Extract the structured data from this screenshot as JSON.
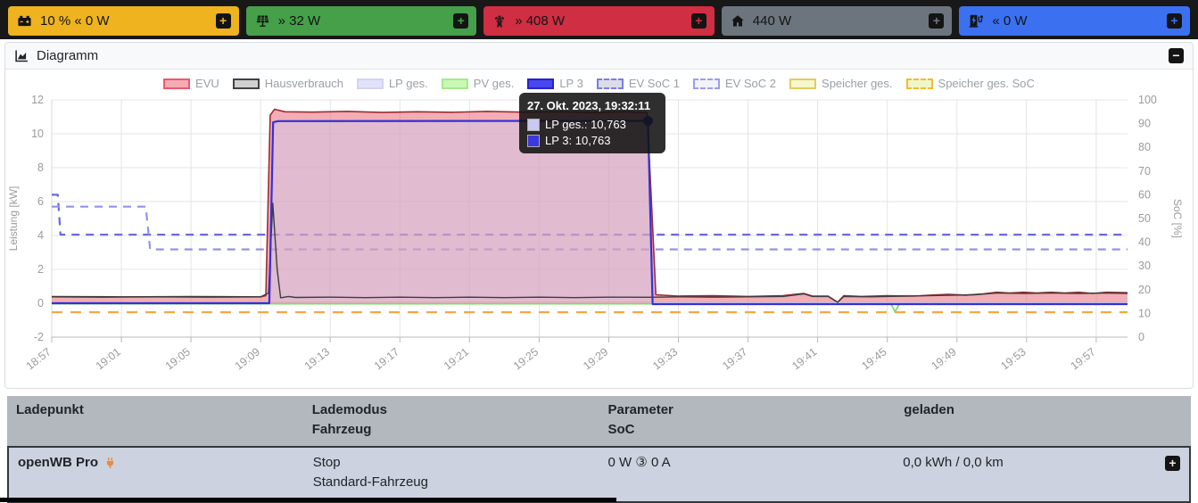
{
  "topbar": {
    "add_button_label": "+",
    "boxes": [
      {
        "name": "battery",
        "icon": "car-battery-icon",
        "color": "#eeb31e",
        "label": "10 % « 0 W"
      },
      {
        "name": "pv",
        "icon": "solar-panel-icon",
        "color": "#45a049",
        "label": "» 32 W"
      },
      {
        "name": "grid",
        "icon": "transmission-tower-icon",
        "color": "#d02e42",
        "label": "» 408 W"
      },
      {
        "name": "house",
        "icon": "home-icon",
        "color": "#6c757d",
        "label": "440 W"
      },
      {
        "name": "chargepoint",
        "icon": "charging-station-icon",
        "color": "#3b71f1",
        "label": "« 0 W"
      }
    ]
  },
  "diagram_panel": {
    "title": "Diagramm",
    "collapse_button_label": "−"
  },
  "tooltip": {
    "title": "27. Okt. 2023, 19:32:11",
    "rows": [
      {
        "swatch": "#c9c9f2",
        "text": "LP ges.: 10,763"
      },
      {
        "swatch": "#3b38dc",
        "text": "LP 3: 10,763"
      }
    ]
  },
  "chart_data": {
    "type": "line",
    "title": "",
    "x_tick_labels": [
      "18:57",
      "19:01",
      "19:05",
      "19:09",
      "19:13",
      "19:17",
      "19:21",
      "19:25",
      "19:29",
      "19:33",
      "19:37",
      "19:41",
      "19:45",
      "19:49",
      "19:53",
      "19:57"
    ],
    "x_tick_minutes": [
      0,
      4,
      8,
      12,
      16,
      20,
      24,
      28,
      32,
      36,
      40,
      44,
      48,
      52,
      56,
      60
    ],
    "x_range": [
      0,
      61.8
    ],
    "grid": true,
    "legend_position": "top",
    "axes": {
      "left": {
        "label": "Leistung [kW]",
        "min": -2,
        "max": 12,
        "ticks": [
          -2,
          0,
          2,
          4,
          6,
          8,
          10,
          12
        ]
      },
      "right": {
        "label": "SoC [%]",
        "min": 0,
        "max": 100,
        "ticks": [
          0,
          10,
          20,
          30,
          40,
          50,
          60,
          70,
          80,
          90,
          100
        ]
      }
    },
    "legend": [
      {
        "label": "EVU",
        "fill": "#f5abb4",
        "stroke": "#ee5a6a",
        "dash": false
      },
      {
        "label": "Hausverbrauch",
        "fill": "#d0d0d0",
        "stroke": "#424242",
        "dash": false
      },
      {
        "label": "LP ges.",
        "fill": "#e2e2f9",
        "stroke": "#d3d3f4",
        "dash": false
      },
      {
        "label": "PV ges.",
        "fill": "#c9f7b4",
        "stroke": "#a6ea8e",
        "dash": false
      },
      {
        "label": "LP 3",
        "fill": "#4a47ec",
        "stroke": "#2724ce",
        "dash": false
      },
      {
        "label": "EV SoC 1",
        "fill": "#dcdce9",
        "stroke": "#7c7ce4",
        "dash": true
      },
      {
        "label": "EV SoC 2",
        "fill": "#f2f2fb",
        "stroke": "#9d9dee",
        "dash": true
      },
      {
        "label": "Speicher ges.",
        "fill": "#f6f8c9",
        "stroke": "#e2ca66",
        "dash": false
      },
      {
        "label": "Speicher ges. SoC",
        "fill": "#f0f6c5",
        "stroke": "#f2ba36",
        "dash": true
      }
    ],
    "series": [
      {
        "name": "EV SoC 1",
        "axis": "right",
        "color": "#6a6ada",
        "width": 2.2,
        "dash": "9 7",
        "points": [
          [
            0,
            60
          ],
          [
            0.35,
            60
          ],
          [
            0.5,
            43.2
          ],
          [
            61.8,
            43.2
          ]
        ]
      },
      {
        "name": "EV SoC 2",
        "axis": "right",
        "color": "#9292ea",
        "width": 2.2,
        "dash": "9 7",
        "points": [
          [
            0,
            55
          ],
          [
            5.4,
            55
          ],
          [
            5.65,
            37
          ],
          [
            61.8,
            37
          ]
        ]
      },
      {
        "name": "Speicher ges. SoC",
        "axis": "right",
        "color": "#f5a844",
        "width": 2.2,
        "dash": "12 9",
        "points": [
          [
            0,
            10.5
          ],
          [
            61.8,
            10.5
          ]
        ]
      },
      {
        "name": "Speicher ges.",
        "axis": "left",
        "color": "#e3dd8d",
        "width": 1.5,
        "points": [
          [
            0,
            0.05
          ],
          [
            61.8,
            0.05
          ]
        ]
      },
      {
        "name": "PV ges.",
        "axis": "left",
        "color": "#7ddb6b",
        "width": 1.8,
        "points": [
          [
            0,
            -0.03
          ],
          [
            48.2,
            -0.03
          ],
          [
            48.45,
            -0.5
          ],
          [
            48.7,
            -0.03
          ],
          [
            61.8,
            -0.03
          ]
        ]
      },
      {
        "name": "EVU",
        "axis": "left",
        "color": "#9e2b36",
        "width": 1.6,
        "fill": "rgba(232,92,106,0.5)",
        "baseline": 0,
        "points": [
          [
            0,
            0.38
          ],
          [
            3,
            0.36
          ],
          [
            6,
            0.38
          ],
          [
            9,
            0.36
          ],
          [
            12,
            0.38
          ],
          [
            12.3,
            0.45
          ],
          [
            12.55,
            11.1
          ],
          [
            12.8,
            11.45
          ],
          [
            13.4,
            11.3
          ],
          [
            15,
            11.28
          ],
          [
            17,
            11.32
          ],
          [
            19,
            11.26
          ],
          [
            21,
            11.3
          ],
          [
            23,
            11.27
          ],
          [
            25,
            11.32
          ],
          [
            27,
            11.28
          ],
          [
            29,
            11.3
          ],
          [
            31,
            11.27
          ],
          [
            33,
            11.3
          ],
          [
            34.2,
            11.25
          ],
          [
            34.45,
            6
          ],
          [
            34.7,
            0.5
          ],
          [
            36,
            0.42
          ],
          [
            38,
            0.44
          ],
          [
            40,
            0.4
          ],
          [
            42,
            0.44
          ],
          [
            43.2,
            0.58
          ],
          [
            43.7,
            0.42
          ],
          [
            44.6,
            0.42
          ],
          [
            45.15,
            0.06
          ],
          [
            45.5,
            0.44
          ],
          [
            46.5,
            0.4
          ],
          [
            48,
            0.44
          ],
          [
            49.5,
            0.42
          ],
          [
            50.5,
            0.48
          ],
          [
            51.5,
            0.52
          ],
          [
            52.5,
            0.48
          ],
          [
            53.5,
            0.55
          ],
          [
            54.3,
            0.65
          ],
          [
            55,
            0.6
          ],
          [
            55.8,
            0.65
          ],
          [
            56.6,
            0.6
          ],
          [
            57.4,
            0.65
          ],
          [
            58.2,
            0.6
          ],
          [
            59,
            0.65
          ],
          [
            59.8,
            0.58
          ],
          [
            60.6,
            0.65
          ],
          [
            61.8,
            0.62
          ]
        ]
      },
      {
        "name": "LP ges.",
        "axis": "left",
        "color": "#c9c9f2",
        "width": 2,
        "fill": "rgba(205,205,240,0.45)",
        "baseline": 0,
        "points": [
          [
            0,
            0.02
          ],
          [
            12.5,
            0.02
          ],
          [
            12.72,
            10.7
          ],
          [
            13,
            10.76
          ],
          [
            34.25,
            10.76
          ],
          [
            34.5,
            0.02
          ],
          [
            61.8,
            0.02
          ]
        ]
      },
      {
        "name": "Hausverbrauch",
        "axis": "left",
        "color": "#3d3d3d",
        "width": 1.4,
        "points": [
          [
            0,
            0.4
          ],
          [
            4,
            0.38
          ],
          [
            8,
            0.4
          ],
          [
            12,
            0.38
          ],
          [
            12.45,
            0.6
          ],
          [
            12.7,
            5.9
          ],
          [
            12.95,
            2
          ],
          [
            13.15,
            0.32
          ],
          [
            13.6,
            0.4
          ],
          [
            14,
            0.34
          ],
          [
            16,
            0.36
          ],
          [
            18,
            0.33
          ],
          [
            20,
            0.36
          ],
          [
            22,
            0.33
          ],
          [
            24,
            0.36
          ],
          [
            26,
            0.33
          ],
          [
            28,
            0.36
          ],
          [
            30,
            0.33
          ],
          [
            32,
            0.36
          ],
          [
            34.3,
            0.35
          ],
          [
            34.8,
            0.36
          ],
          [
            36,
            0.38
          ],
          [
            38,
            0.36
          ],
          [
            40,
            0.38
          ],
          [
            42,
            0.4
          ],
          [
            43.2,
            0.55
          ],
          [
            43.7,
            0.4
          ],
          [
            44.6,
            0.4
          ],
          [
            45.15,
            0.06
          ],
          [
            45.5,
            0.4
          ],
          [
            47,
            0.38
          ],
          [
            49,
            0.42
          ],
          [
            51,
            0.46
          ],
          [
            53,
            0.5
          ],
          [
            54.3,
            0.6
          ],
          [
            55.8,
            0.58
          ],
          [
            57.4,
            0.6
          ],
          [
            59,
            0.58
          ],
          [
            60.6,
            0.6
          ],
          [
            61.8,
            0.58
          ]
        ]
      },
      {
        "name": "LP 3",
        "axis": "left",
        "color": "#3430d8",
        "width": 2.2,
        "points": [
          [
            0,
            0
          ],
          [
            12.5,
            0
          ],
          [
            12.72,
            10.68
          ],
          [
            13,
            10.75
          ],
          [
            34.25,
            10.763
          ],
          [
            34.52,
            -0.05
          ],
          [
            61.8,
            -0.05
          ]
        ]
      }
    ],
    "marker": {
      "series": "LP 3",
      "t": 34.25,
      "value": 10.763,
      "color": "#2c28c8"
    }
  },
  "table": {
    "headers": [
      [
        "Ladepunkt",
        ""
      ],
      [
        "Lademodus",
        "Fahrzeug"
      ],
      [
        "Parameter",
        "SoC"
      ],
      [
        "geladen",
        ""
      ]
    ],
    "rows": [
      {
        "name": "openWB Pro",
        "mode": [
          "Stop",
          "Standard-Fahrzeug"
        ],
        "parameter": [
          "0 W ③ 0 A",
          ""
        ],
        "charged": [
          "0,0 kWh / 0,0 km",
          ""
        ],
        "expand_label": "+"
      }
    ]
  }
}
